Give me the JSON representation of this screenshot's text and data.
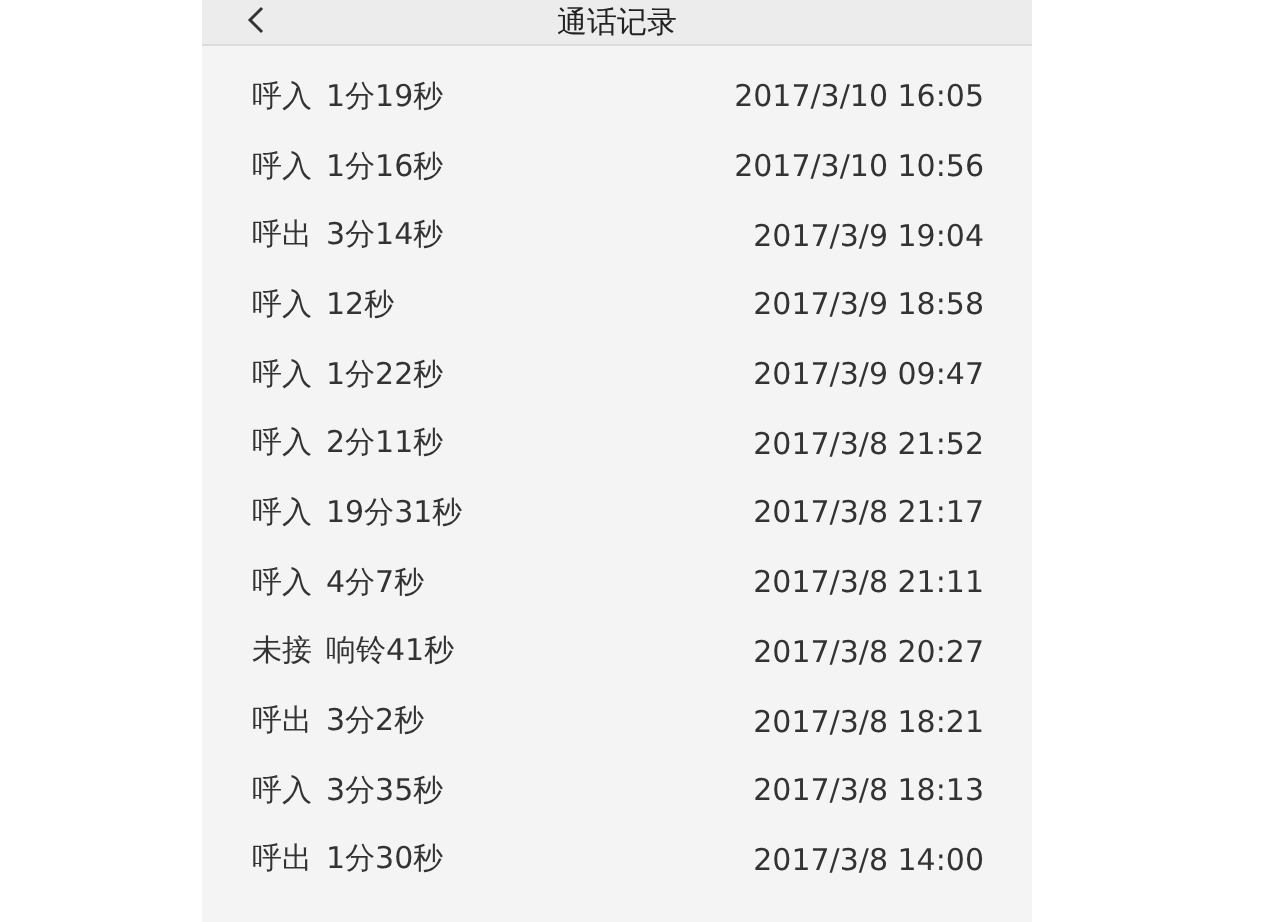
{
  "header": {
    "title": "通话记录"
  },
  "calls": [
    {
      "type": "呼入",
      "duration": "1分19秒",
      "time": "2017/3/10 16:05"
    },
    {
      "type": "呼入",
      "duration": "1分16秒",
      "time": "2017/3/10 10:56"
    },
    {
      "type": "呼出",
      "duration": "3分14秒",
      "time": "2017/3/9 19:04"
    },
    {
      "type": "呼入",
      "duration": "12秒",
      "time": "2017/3/9 18:58"
    },
    {
      "type": "呼入",
      "duration": "1分22秒",
      "time": "2017/3/9 09:47"
    },
    {
      "type": "呼入",
      "duration": "2分11秒",
      "time": "2017/3/8 21:52"
    },
    {
      "type": "呼入",
      "duration": "19分31秒",
      "time": "2017/3/8 21:17"
    },
    {
      "type": "呼入",
      "duration": "4分7秒",
      "time": "2017/3/8 21:11"
    },
    {
      "type": "未接",
      "duration": "响铃41秒",
      "time": "2017/3/8 20:27"
    },
    {
      "type": "呼出",
      "duration": "3分2秒",
      "time": "2017/3/8 18:21"
    },
    {
      "type": "呼入",
      "duration": "3分35秒",
      "time": "2017/3/8 18:13"
    },
    {
      "type": "呼出",
      "duration": "1分30秒",
      "time": "2017/3/8 14:00"
    }
  ]
}
